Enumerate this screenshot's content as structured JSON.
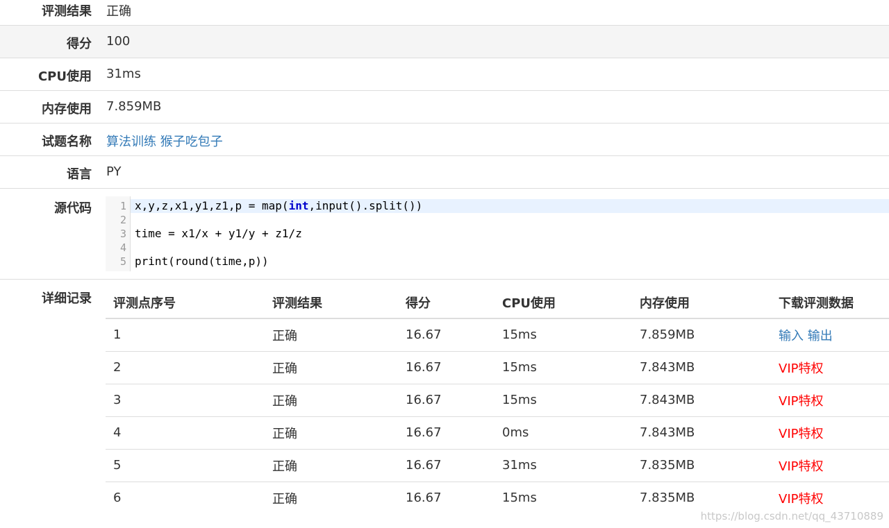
{
  "summary": [
    {
      "label": "评测结果",
      "value": "正确"
    },
    {
      "label": "得分",
      "value": "100"
    },
    {
      "label": "CPU使用",
      "value": "31ms"
    },
    {
      "label": "内存使用",
      "value": "7.859MB"
    },
    {
      "label": "试题名称",
      "value": "算法训练 猴子吃包子"
    },
    {
      "label": "语言",
      "value": "PY"
    }
  ],
  "source": {
    "label": "源代码",
    "lines": [
      {
        "num": "1",
        "pre": "x,y,z,x1,y1,z1,p = map(",
        "kw": "int",
        "post": ",input().split())"
      },
      {
        "num": "2",
        "pre": "",
        "kw": "",
        "post": ""
      },
      {
        "num": "3",
        "pre": "time = x1/x + y1/y + z1/z",
        "kw": "",
        "post": ""
      },
      {
        "num": "4",
        "pre": "",
        "kw": "",
        "post": ""
      },
      {
        "num": "5",
        "pre": "print(round(time,p))",
        "kw": "",
        "post": ""
      }
    ]
  },
  "details": {
    "label": "详细记录",
    "headers": [
      "评测点序号",
      "评测结果",
      "得分",
      "CPU使用",
      "内存使用",
      "下载评测数据"
    ],
    "rows": [
      [
        "1",
        "正确",
        "16.67",
        "15ms",
        "7.859MB"
      ],
      [
        "2",
        "正确",
        "16.67",
        "15ms",
        "7.843MB"
      ],
      [
        "3",
        "正确",
        "16.67",
        "15ms",
        "7.843MB"
      ],
      [
        "4",
        "正确",
        "16.67",
        "0ms",
        "7.843MB"
      ],
      [
        "5",
        "正确",
        "16.67",
        "31ms",
        "7.835MB"
      ],
      [
        "6",
        "正确",
        "16.67",
        "15ms",
        "7.835MB"
      ]
    ],
    "download_input": "输入",
    "download_output": "输出",
    "vip_label": "VIP特权"
  },
  "watermark": "https://blog.csdn.net/qq_43710889",
  "colors": {
    "link": "#337ab7",
    "vip": "#ff0000",
    "keyword": "#0000cc"
  }
}
